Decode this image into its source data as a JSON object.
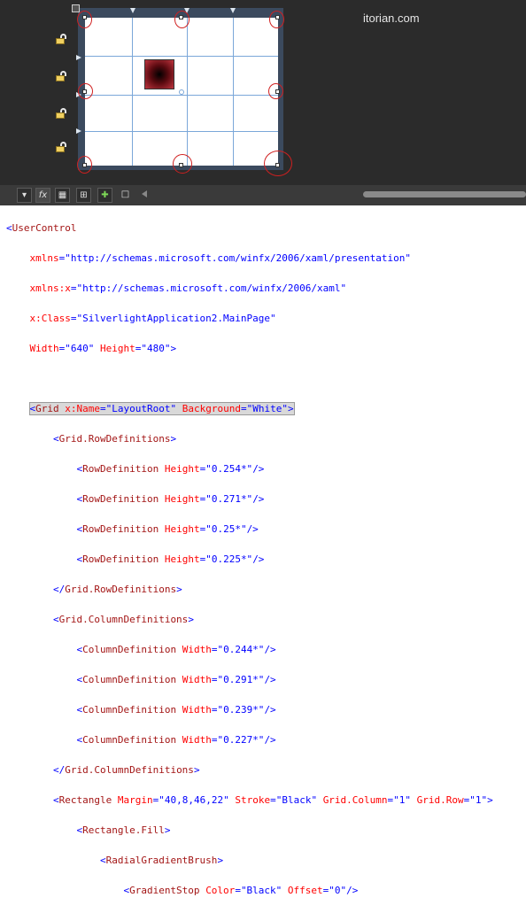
{
  "watermark": "itorian.com",
  "toolbar": {
    "fx_label": "fx",
    "buttons": [
      "dropdown-icon",
      "effects-icon",
      "grid-icon",
      "snap-grid-icon",
      "add-gridline-icon",
      "annotation-icon",
      "scroll-left-icon"
    ]
  },
  "code": {
    "user_control_open": "<UserControl",
    "xmlns_attr": "xmlns",
    "xmlns_val": "\"http://schemas.microsoft.com/winfx/2006/xaml/presentation\"",
    "xmlns_x_attr": "xmlns:x",
    "xmlns_x_val": "\"http://schemas.microsoft.com/winfx/2006/xaml\"",
    "class_attr": "x:Class",
    "class_val": "\"SilverlightApplication2.MainPage\"",
    "width_attr": "Width",
    "width_val": "\"640\"",
    "height_attr": "Height",
    "height_val": "\"480\"",
    "grid_tag": "Grid",
    "name_attr": "x:Name",
    "name_val": "\"LayoutRoot\"",
    "bg_attr": "Background",
    "bg_val": "\"White\"",
    "row_defs_tag": "Grid.RowDefinitions",
    "row_def_tag": "RowDefinition",
    "row_height_attr": "Height",
    "rows": [
      "\"0.254*\"",
      "\"0.271*\"",
      "\"0.25*\"",
      "\"0.225*\""
    ],
    "col_defs_tag": "Grid.ColumnDefinitions",
    "col_def_tag": "ColumnDefinition",
    "col_width_attr": "Width",
    "cols": [
      "\"0.244*\"",
      "\"0.291*\"",
      "\"0.239*\"",
      "\"0.227*\""
    ],
    "rect_tag": "Rectangle",
    "margin_attr": "Margin",
    "margin_val": "\"40,8,46,22\"",
    "stroke_attr": "Stroke",
    "stroke_val": "\"Black\"",
    "gcol_attr": "Grid.Column",
    "gcol_val": "\"1\"",
    "grow_attr": "Grid.Row",
    "grow_val": "\"1\"",
    "rect_fill_tag": "Rectangle.Fill",
    "brush_tag": "RadialGradientBrush",
    "stop_tag": "GradientStop",
    "color_attr": "Color",
    "color_val": "\"Black\"",
    "offset_attr": "Offset",
    "offset_val": "\"0\""
  }
}
